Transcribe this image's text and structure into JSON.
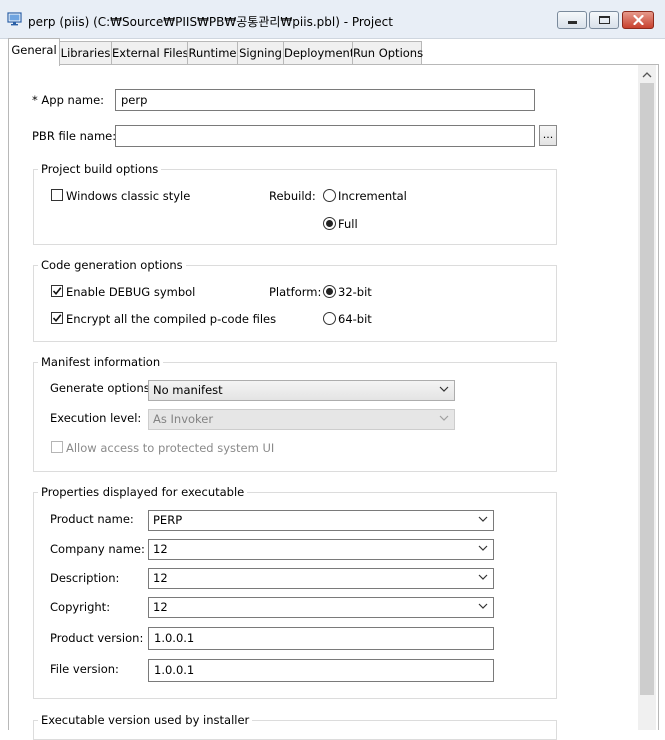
{
  "window": {
    "title": "perp (piis) (C:₩Source₩PIIS₩PB₩공통관리₩piis.pbl) - Project"
  },
  "tabs": [
    {
      "label": "General",
      "active": true
    },
    {
      "label": "Libraries"
    },
    {
      "label": "External Files"
    },
    {
      "label": "Runtime"
    },
    {
      "label": "Signing"
    },
    {
      "label": "Deployment"
    },
    {
      "label": "Run Options"
    }
  ],
  "general": {
    "app_name_label": "* App name:",
    "app_name_value": "perp",
    "pbr_label": "PBR file name:",
    "pbr_value": "",
    "browse_label": "...",
    "build": {
      "title": "Project build options",
      "windows_classic_label": "Windows classic style",
      "windows_classic_checked": false,
      "rebuild_label": "Rebuild:",
      "incremental_label": "Incremental",
      "full_label": "Full",
      "selected": "Full"
    },
    "codegen": {
      "title": "Code generation options",
      "debug_label": "Enable DEBUG symbol",
      "debug_checked": true,
      "encrypt_label": "Encrypt all the compiled p-code files",
      "encrypt_checked": true,
      "platform_label": "Platform:",
      "bit32_label": "32-bit",
      "bit64_label": "64-bit",
      "selected": "32-bit"
    },
    "manifest": {
      "title": "Manifest information",
      "generate_label": "Generate options:",
      "generate_value": "No manifest",
      "exec_level_label": "Execution level:",
      "exec_level_value": "As Invoker",
      "allow_ui_label": "Allow access to protected system UI",
      "allow_ui_checked": false
    },
    "properties": {
      "title": "Properties displayed for executable",
      "product_name_label": "Product name:",
      "product_name_value": "PERP",
      "company_label": "Company name:",
      "company_value": "12",
      "description_label": "Description:",
      "description_value": "12",
      "copyright_label": "Copyright:",
      "copyright_value": "12",
      "product_version_label": "Product version:",
      "product_version_value": "1.0.0.1",
      "file_version_label": "File version:",
      "file_version_value": "1.0.0.1"
    },
    "installer_title": "Executable version used by installer"
  },
  "colors": {
    "titlebar": "#e8eef6",
    "close_button": "#c8412e",
    "scroll_thumb": "#cdcdcd"
  },
  "icons": [
    "project-icon",
    "minimize-icon",
    "maximize-icon",
    "close-icon",
    "chevron-down-icon",
    "scroll-up-icon"
  ]
}
